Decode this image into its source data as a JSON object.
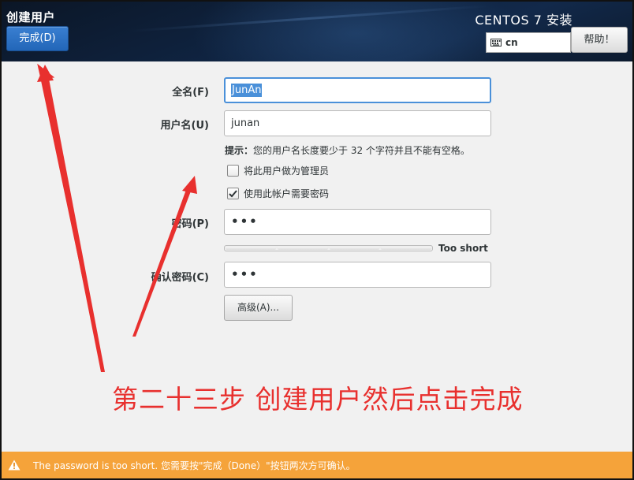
{
  "header": {
    "spoke_title": "创建用户",
    "done_label": "完成(D)",
    "product_title": "CENTOS 7 安装",
    "keyboard_layout": "cn",
    "help_label": "帮助！"
  },
  "form": {
    "fullname_label": "全名(F)",
    "fullname_value": "JunAn",
    "username_label": "用户名(U)",
    "username_value": "junan",
    "hint_prefix": "提示：",
    "hint_text": "您的用户名长度要少于 32 个字符并且不能有空格。",
    "admin_checkbox_label": "将此用户做为管理员",
    "admin_checked": false,
    "require_password_label": "使用此帐户需要密码",
    "require_password_checked": true,
    "password_label": "密码(P)",
    "password_mask": "•••",
    "strength_label": "Too short",
    "confirm_label": "确认密码(C)",
    "confirm_mask": "•••",
    "advanced_label": "高级(A)..."
  },
  "annotation": {
    "text": "第二十三步 创建用户然后点击完成",
    "color": "#e8302e"
  },
  "statusbar": {
    "message": "The password is too short. 您需要按\"完成（Done）\"按钮两次方可确认。",
    "color": "#f5a33a"
  },
  "icons": {
    "keyboard": "keyboard-icon",
    "warning": "warning-icon",
    "checkmark": "checkmark-icon"
  }
}
